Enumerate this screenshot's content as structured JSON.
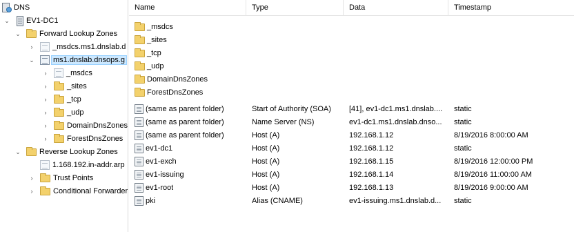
{
  "tree": {
    "root": "DNS",
    "server": "EV1-DC1",
    "forward_zones": "Forward Lookup Zones",
    "msdcs_zone": "_msdcs.ms1.dnslab.d",
    "main_zone": "ms1.dnslab.dnsops.g",
    "subfolders": [
      "_msdcs",
      "_sites",
      "_tcp",
      "_udp",
      "DomainDnsZones",
      "ForestDnsZones"
    ],
    "reverse_zones": "Reverse Lookup Zones",
    "reverse_zone": "1.168.192.in-addr.arp",
    "trust_points": "Trust Points",
    "conditional_forwarders": "Conditional Forwarders"
  },
  "columns": {
    "name": "Name",
    "type": "Type",
    "data": "Data",
    "timestamp": "Timestamp"
  },
  "folder_rows": [
    "_msdcs",
    "_sites",
    "_tcp",
    "_udp",
    "DomainDnsZones",
    "ForestDnsZones"
  ],
  "records": [
    {
      "name": "(same as parent folder)",
      "type": "Start of Authority (SOA)",
      "data": "[41], ev1-dc1.ms1.dnslab....",
      "timestamp": "static"
    },
    {
      "name": "(same as parent folder)",
      "type": "Name Server (NS)",
      "data": "ev1-dc1.ms1.dnslab.dnso...",
      "timestamp": "static"
    },
    {
      "name": "(same as parent folder)",
      "type": "Host (A)",
      "data": "192.168.1.12",
      "timestamp": "8/19/2016 8:00:00 AM"
    },
    {
      "name": "ev1-dc1",
      "type": "Host (A)",
      "data": "192.168.1.12",
      "timestamp": "static"
    },
    {
      "name": "ev1-exch",
      "type": "Host (A)",
      "data": "192.168.1.15",
      "timestamp": "8/19/2016 12:00:00 PM"
    },
    {
      "name": "ev1-issuing",
      "type": "Host (A)",
      "data": "192.168.1.14",
      "timestamp": "8/19/2016 11:00:00 AM"
    },
    {
      "name": "ev1-root",
      "type": "Host (A)",
      "data": "192.168.1.13",
      "timestamp": "8/19/2016 9:00:00 AM"
    },
    {
      "name": "pki",
      "type": "Alias (CNAME)",
      "data": "ev1-issuing.ms1.dnslab.d...",
      "timestamp": "static"
    }
  ]
}
